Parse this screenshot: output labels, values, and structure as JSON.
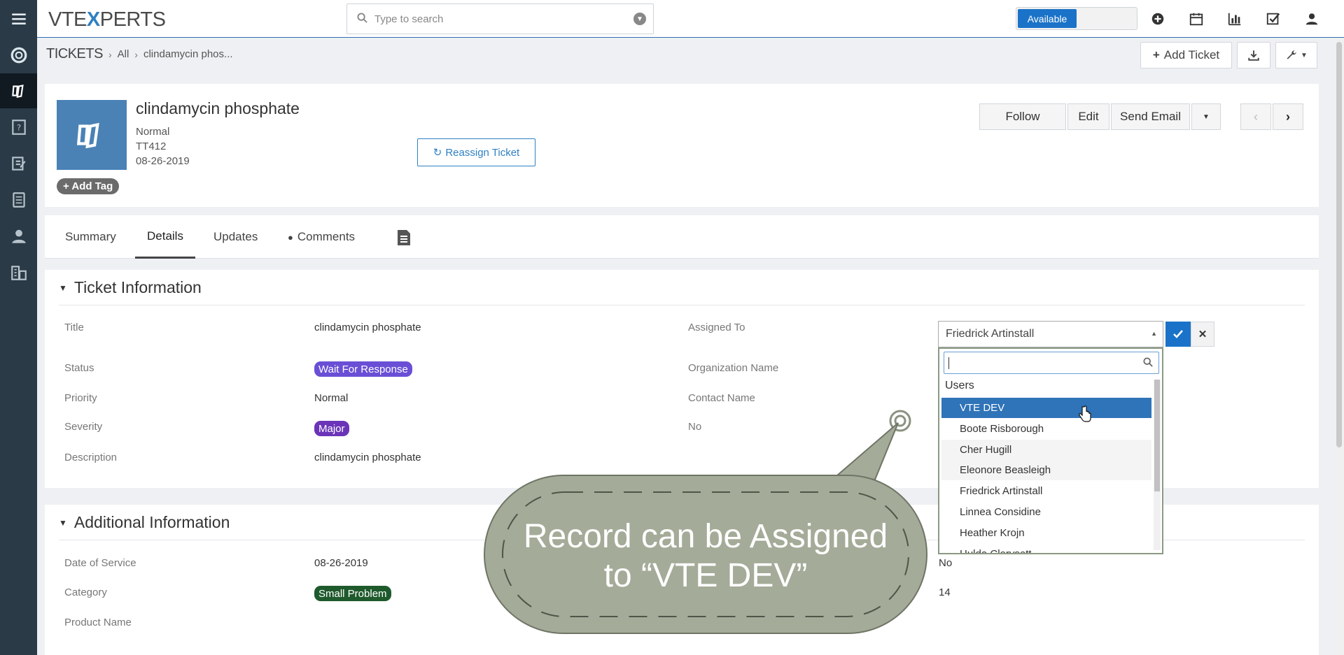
{
  "brand": {
    "logo_part1": "VTE",
    "logo_x": "X",
    "logo_part2": "PERTS"
  },
  "search": {
    "placeholder": "Type to search"
  },
  "status_toggle": {
    "label": "Available",
    "color": "#1a73c8"
  },
  "top_icons": [
    "plus-circle-icon",
    "calendar-icon",
    "chart-icon",
    "tasks-icon",
    "user-icon"
  ],
  "sidebar": {
    "items": [
      "menu-icon",
      "help-desk-icon",
      "tickets-icon",
      "faq-icon",
      "project-icon",
      "calculator-icon",
      "contacts-icon",
      "organizations-icon"
    ]
  },
  "breadcrumb": {
    "module": "TICKETS",
    "filter": "All",
    "record": "clindamycin phos..."
  },
  "header_actions": {
    "add_ticket": "Add Ticket",
    "import_icon": "download-icon",
    "settings_icon": "wrench-icon"
  },
  "record": {
    "title": "clindamycin phosphate",
    "priority": "Normal",
    "number": "TT412",
    "date": "08-26-2019",
    "add_tag": "+ Add Tag",
    "reassign": "Reassign Ticket",
    "actions": {
      "follow": "Follow",
      "edit": "Edit",
      "send_email": "Send Email"
    }
  },
  "tabs": {
    "summary": "Summary",
    "details": "Details",
    "updates": "Updates",
    "comments": "Comments"
  },
  "ticket_info": {
    "title": "Ticket Information",
    "fields": {
      "title_label": "Title",
      "title_value": "clindamycin phosphate",
      "status_label": "Status",
      "status_value": "Wait For Response",
      "status_color": "#6a4fd6",
      "priority_label": "Priority",
      "priority_value": "Normal",
      "severity_label": "Severity",
      "severity_value": "Major",
      "severity_color": "#6b34b8",
      "description_label": "Description",
      "description_value": "clindamycin phosphate",
      "assigned_label": "Assigned To",
      "org_label": "Organization Name",
      "contact_label": "Contact Name",
      "no_label": "No"
    }
  },
  "additional_info": {
    "title": "Additional Information",
    "fields": {
      "date_label": "Date of Service",
      "date_value": "08-26-2019",
      "category_label": "Category",
      "category_value": "Small Problem",
      "category_color": "#1f5a2c",
      "product_label": "Product Name",
      "right_value_1": "No",
      "right_value_2": "14"
    }
  },
  "assign_select": {
    "selected": "Friedrick Artinstall",
    "group": "Users",
    "options": [
      "VTE DEV",
      "Boote Risborough",
      "Cher Hugill",
      "Eleonore Beasleigh",
      "Friedrick Artinstall",
      "Linnea Considine",
      "Heather Krojn",
      "Hulda Clorysett"
    ]
  },
  "callout": {
    "line1": "Record can be Assigned",
    "line2": "to “VTE DEV”",
    "fill": "#a4ab98"
  }
}
